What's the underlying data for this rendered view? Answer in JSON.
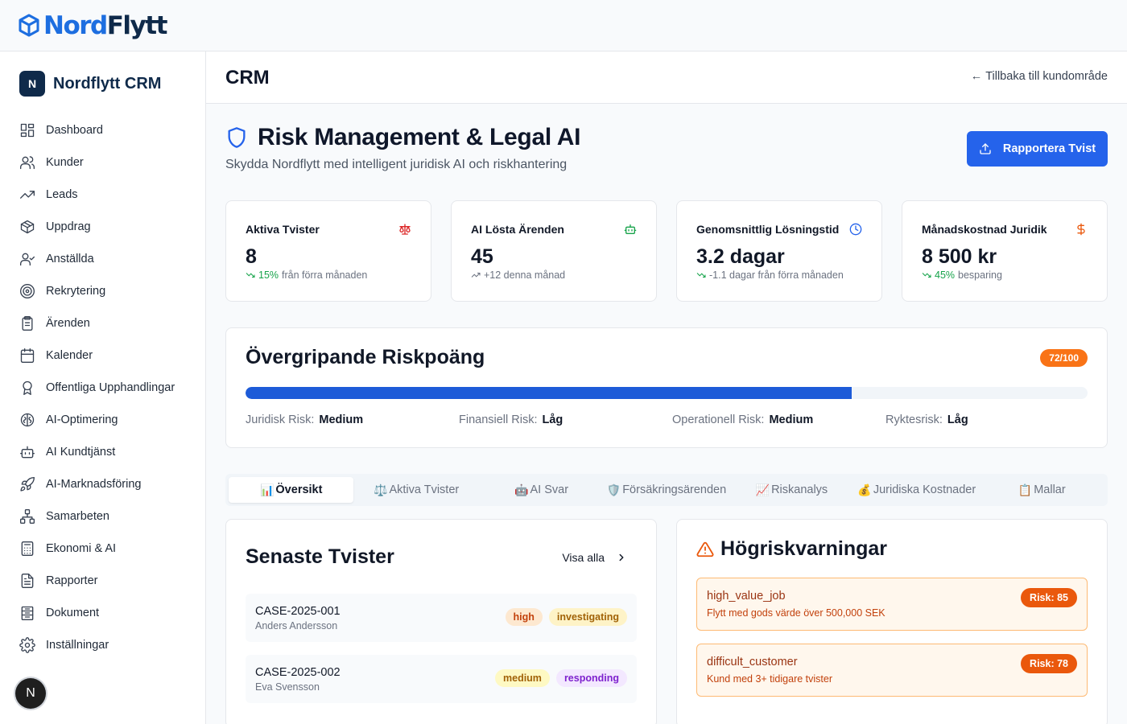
{
  "brand": {
    "part1": "Nord",
    "part2": "Flytt"
  },
  "sidebar": {
    "logo_letter": "N",
    "logo_name": "Nordflytt CRM",
    "items": [
      {
        "label": "Dashboard",
        "icon": "dashboard-icon"
      },
      {
        "label": "Kunder",
        "icon": "users-icon"
      },
      {
        "label": "Leads",
        "icon": "trending-up-icon"
      },
      {
        "label": "Uppdrag",
        "icon": "package-icon"
      },
      {
        "label": "Anställda",
        "icon": "user-check-icon"
      },
      {
        "label": "Rekrytering",
        "icon": "target-icon"
      },
      {
        "label": "Ärenden",
        "icon": "clipboard-icon"
      },
      {
        "label": "Kalender",
        "icon": "calendar-icon"
      },
      {
        "label": "Offentliga Upphandlingar",
        "icon": "award-icon"
      },
      {
        "label": "AI-Optimering",
        "icon": "brain-icon"
      },
      {
        "label": "AI Kundtjänst",
        "icon": "bot-icon"
      },
      {
        "label": "AI-Marknadsföring",
        "icon": "rocket-icon"
      },
      {
        "label": "Samarbeten",
        "icon": "network-icon"
      },
      {
        "label": "Ekonomi & AI",
        "icon": "calculator-icon"
      },
      {
        "label": "Rapporter",
        "icon": "file-text-icon"
      },
      {
        "label": "Dokument",
        "icon": "library-icon"
      },
      {
        "label": "Inställningar",
        "icon": "settings-icon"
      }
    ],
    "avatar_letter": "N"
  },
  "header": {
    "title": "CRM",
    "back_label": "Tillbaka till kundområde"
  },
  "page": {
    "title": "Risk Management & Legal AI",
    "subtitle": "Skydda Nordflytt med intelligent juridisk AI och riskhantering",
    "report_button": "Rapportera Tvist"
  },
  "stats": [
    {
      "label": "Aktiva Tvister",
      "value": "8",
      "delta_strong": "15%",
      "delta_rest": "från förra månaden",
      "icon": "scale-icon",
      "icon_color": "#dc2626"
    },
    {
      "label": "AI Lösta Ärenden",
      "value": "45",
      "delta_strong": "",
      "delta_rest": "+12 denna månad",
      "icon": "bot-icon",
      "icon_color": "#16a34a"
    },
    {
      "label": "Genomsnittlig Lösningstid",
      "value": "3.2 dagar",
      "delta_strong": "",
      "delta_rest": "-1.1 dagar från förra månaden",
      "icon": "clock-icon",
      "icon_color": "#2563eb"
    },
    {
      "label": "Månadskostnad Juridik",
      "value": "8 500 kr",
      "delta_strong": "45%",
      "delta_rest": "besparing",
      "icon": "dollar-icon",
      "icon_color": "#ea580c"
    }
  ],
  "risk": {
    "title": "Övergripande Riskpoäng",
    "badge": "72/100",
    "score": 72,
    "max": 100,
    "items": [
      {
        "label": "Juridisk Risk:",
        "value": "Medium"
      },
      {
        "label": "Finansiell Risk:",
        "value": "Låg"
      },
      {
        "label": "Operationell Risk:",
        "value": "Medium"
      },
      {
        "label": "Ryktesrisk:",
        "value": "Låg"
      }
    ]
  },
  "tabs": [
    {
      "emoji": "📊",
      "label": "Översikt"
    },
    {
      "emoji": "⚖️",
      "label": "Aktiva Tvister"
    },
    {
      "emoji": "🤖",
      "label": "AI Svar"
    },
    {
      "emoji": "🛡️",
      "label": "Försäkringsärenden"
    },
    {
      "emoji": "📈",
      "label": "Riskanalys"
    },
    {
      "emoji": "💰",
      "label": "Juridiska Kostnader"
    },
    {
      "emoji": "📋",
      "label": "Mallar"
    }
  ],
  "latest": {
    "title": "Senaste Tvister",
    "view_all": "Visa alla",
    "cases": [
      {
        "id": "CASE-2025-001",
        "customer": "Anders Andersson",
        "severity": "high",
        "status": "investigating"
      },
      {
        "id": "CASE-2025-002",
        "customer": "Eva Svensson",
        "severity": "medium",
        "status": "responding"
      }
    ]
  },
  "warnings": {
    "title": "Högriskvarningar",
    "items": [
      {
        "type": "high_value_job",
        "desc": "Flytt med gods värde över 500,000 SEK",
        "badge": "Risk: 85"
      },
      {
        "type": "difficult_customer",
        "desc": "Kund med 3+ tidigare tvister",
        "badge": "Risk: 78"
      }
    ]
  }
}
